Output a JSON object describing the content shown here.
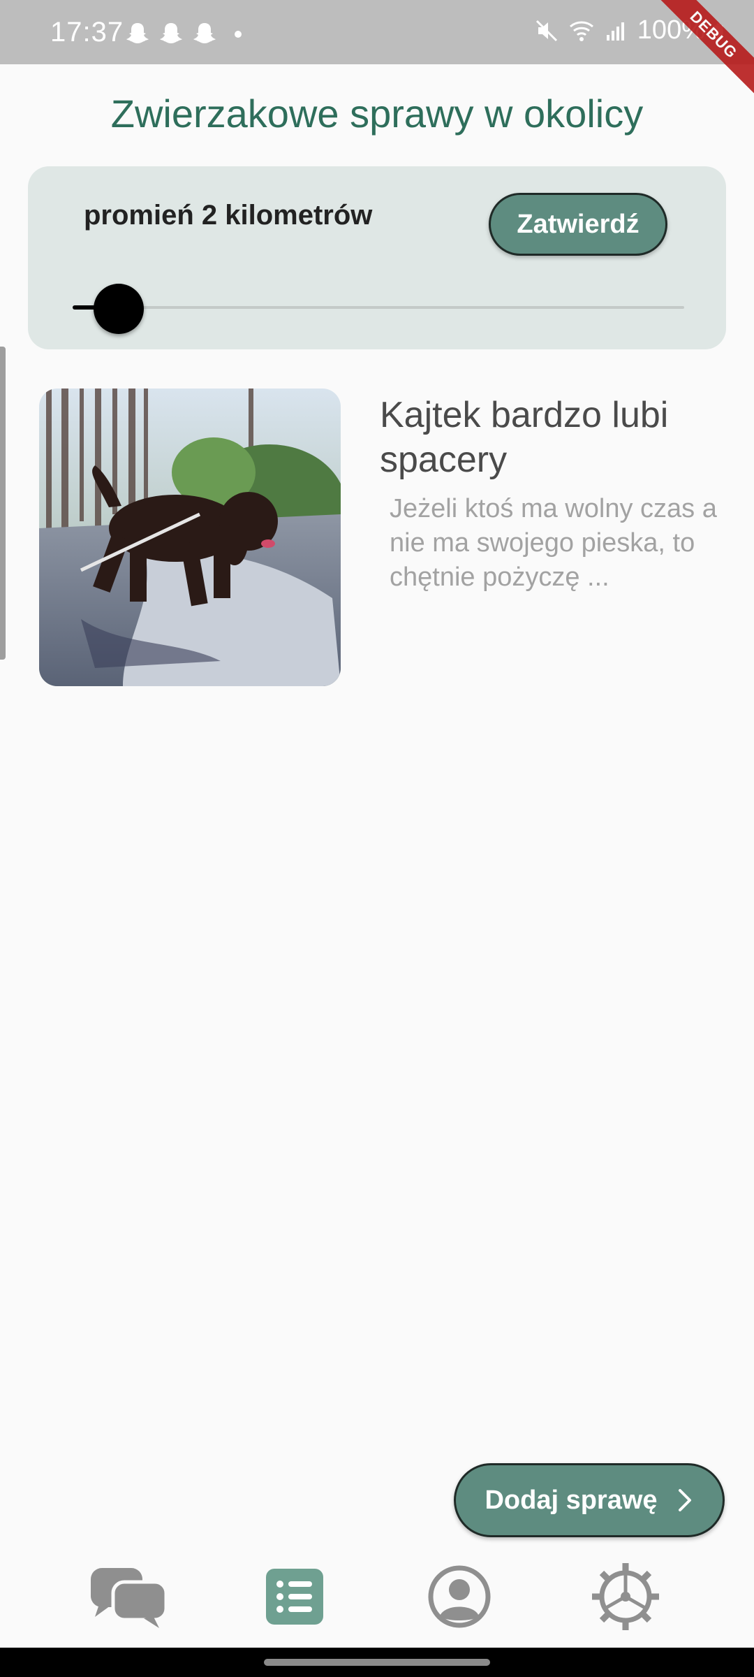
{
  "status_bar": {
    "time": "17:37",
    "notification_icons": [
      "snapchat-icon",
      "snapchat-icon",
      "snapchat-icon"
    ],
    "battery": "100%",
    "debug_label": "DEBUG"
  },
  "header": {
    "title": "Zwierzakowe sprawy w okolicy"
  },
  "radius_filter": {
    "label": "promień 2 kilometrów",
    "confirm_label": "Zatwierdź",
    "slider_value_km": 2
  },
  "posts": [
    {
      "title": "Kajtek bardzo lubi spacery",
      "description": "Jeżeli ktoś ma wolny czas a nie ma swojego pieska, to chętnie pożyczę ..."
    }
  ],
  "actions": {
    "add_label": "Dodaj sprawę"
  },
  "nav": {
    "items": [
      {
        "icon": "chat-icon"
      },
      {
        "icon": "list-icon",
        "active": true
      },
      {
        "icon": "profile-icon"
      },
      {
        "icon": "settings-icon"
      }
    ]
  },
  "colors": {
    "accent": "#5e8c80",
    "title": "#2e6e5b",
    "card_bg": "#dfe7e5",
    "inactive_icon": "#8f8f8f"
  }
}
